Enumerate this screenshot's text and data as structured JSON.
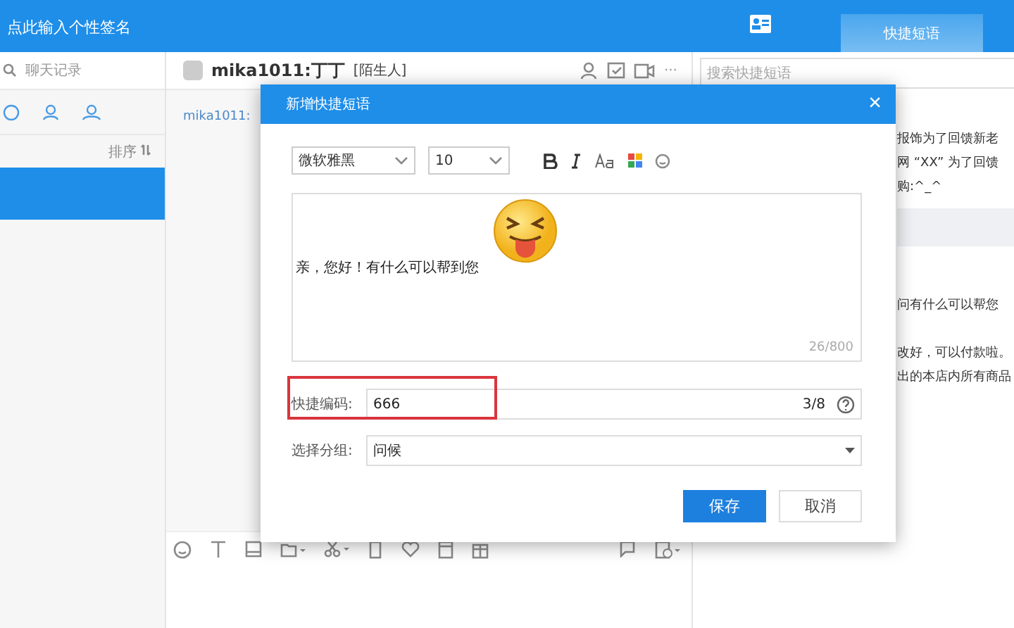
{
  "top_bar": {
    "signature": "点此输入个性签名",
    "tabs": [
      {
        "label": "快捷短语",
        "selected": true
      }
    ]
  },
  "sidebar": {
    "search_placeholder": "聊天记录",
    "sort_label": "排序",
    "conversations": [
      {
        "selected": true
      }
    ]
  },
  "chat": {
    "contact": "mika1011:丁丁",
    "tag": "[陌生人]",
    "sender": "mika1011:",
    "more": "···"
  },
  "phrases": {
    "search_placeholder": "搜索快捷短语",
    "items": [
      {
        "kind": "phrase",
        "text": "报饰为了回馈新老"
      },
      {
        "kind": "phrase",
        "text": "网 “XX” 为了回馈"
      },
      {
        "kind": "phrase",
        "text": "购:^_^"
      },
      {
        "kind": "group"
      },
      {
        "kind": "phrase",
        "text": "问有什么可以帮您"
      },
      {
        "kind": "gap"
      },
      {
        "kind": "phrase",
        "text": "改好，可以付款啦。"
      },
      {
        "kind": "phrase",
        "text": "出的本店内所有商品"
      }
    ]
  },
  "dialog": {
    "title": "新增快捷短语",
    "close": "×",
    "font": "微软雅黑",
    "size": "10",
    "content": "亲，您好！有什么可以帮到您",
    "counter": "26/800",
    "code": {
      "label": "快捷编码:",
      "value": "666",
      "counter": "3/8",
      "highlighted": true
    },
    "group": {
      "label": "选择分组:",
      "value": "问候"
    },
    "buttons": [
      {
        "label": "保存",
        "kind": "primary"
      },
      {
        "label": "取消",
        "kind": "secondary"
      }
    ]
  }
}
